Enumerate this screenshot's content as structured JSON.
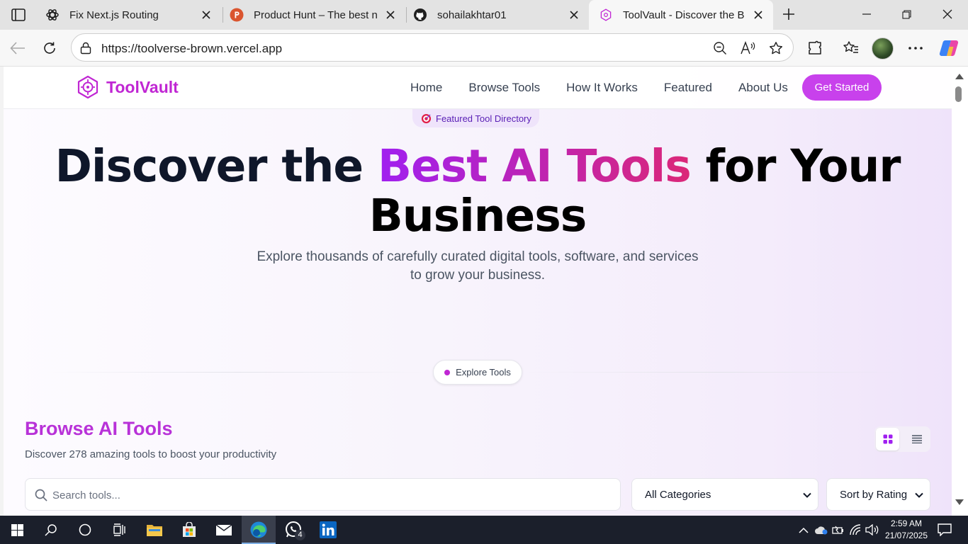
{
  "browser": {
    "tabs": [
      {
        "title": "Fix Next.js Routing",
        "icon": "chatgpt-icon",
        "active": false
      },
      {
        "title": "Product Hunt – The best ne",
        "icon": "product-hunt-icon",
        "active": false
      },
      {
        "title": "sohailakhtar01",
        "icon": "github-icon",
        "active": false
      },
      {
        "title": "ToolVault - Discover the Bes",
        "icon": "toolvault-icon",
        "active": true
      }
    ],
    "url": "https://toolverse-brown.vercel.app"
  },
  "site": {
    "brand": "ToolVault",
    "nav": [
      "Home",
      "Browse Tools",
      "How It Works",
      "Featured",
      "About Us"
    ],
    "cta": "Get Started"
  },
  "hero": {
    "badge": "Featured Tool Directory",
    "title_part1": "Discover the ",
    "title_highlight": "Best AI Tools",
    "title_part2": " for Your Business",
    "subtitle": "Explore thousands of carefully curated digital tools, software, and services to grow your business."
  },
  "explore": {
    "label": "Explore Tools"
  },
  "browse": {
    "title": "Browse AI Tools",
    "subtitle": "Discover 278 amazing tools to boost your productivity",
    "search_placeholder": "Search tools...",
    "category_select": "All Categories",
    "sort_select": "Sort by Rating"
  },
  "taskbar": {
    "time": "2:59 AM",
    "date": "21/07/2025",
    "whatsapp_badge": "4"
  },
  "colors": {
    "brand": "#c026d3",
    "cta": "#c841ec",
    "gradient_start": "#a020f0",
    "gradient_end": "#db2777"
  }
}
